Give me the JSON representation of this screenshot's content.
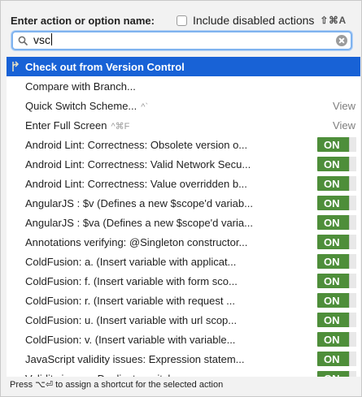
{
  "header": {
    "title": "Enter action or option name:",
    "include_disabled_label": "Include disabled actions",
    "shortcut": "⇧⌘A"
  },
  "search": {
    "query": "vsc",
    "icon": "search-icon"
  },
  "items": [
    {
      "label": "Check out from Version Control",
      "hint": "",
      "right": "",
      "selected": true,
      "icon": "vcs-checkout-icon"
    },
    {
      "label": "Compare with Branch...",
      "hint": "",
      "right": ""
    },
    {
      "label": "Quick Switch Scheme...",
      "hint": "^`",
      "right": "View"
    },
    {
      "label": "Enter Full Screen",
      "hint": "^⌘F",
      "right": "View"
    },
    {
      "label": "Android Lint: Correctness: Obsolete version o...",
      "hint": "",
      "right": "ON"
    },
    {
      "label": "Android Lint: Correctness: Valid Network Secu...",
      "hint": "",
      "right": "ON"
    },
    {
      "label": "Android Lint: Correctness: Value overridden b...",
      "hint": "",
      "right": "ON"
    },
    {
      "label": "AngularJS : $v (Defines a new $scope'd variab...",
      "hint": "",
      "right": "ON"
    },
    {
      "label": "AngularJS : $va (Defines a new $scope'd varia...",
      "hint": "",
      "right": "ON"
    },
    {
      "label": "Annotations verifying: @Singleton constructor...",
      "hint": "",
      "right": "ON"
    },
    {
      "label": "ColdFusion: a. (Insert variable with applicat...",
      "hint": "",
      "right": "ON"
    },
    {
      "label": "ColdFusion: f. (Insert variable with form sco...",
      "hint": "",
      "right": "ON"
    },
    {
      "label": "ColdFusion: r. (Insert variable with request ...",
      "hint": "",
      "right": "ON"
    },
    {
      "label": "ColdFusion: u. (Insert variable with url scop...",
      "hint": "",
      "right": "ON"
    },
    {
      "label": "ColdFusion: v. (Insert variable with variable...",
      "hint": "",
      "right": "ON"
    },
    {
      "label": "JavaScript validity issues: Expression statem...",
      "hint": "",
      "right": "ON"
    },
    {
      "label": "Validity issues: Duplicate switch case",
      "hint": "",
      "right": "ON"
    }
  ],
  "footer": {
    "text": "Press ⌥⏎ to assign a shortcut for the selected action"
  },
  "colors": {
    "selection": "#1862d6",
    "toggle_on": "#4e8e3a",
    "search_focus": "#7fb3ef"
  }
}
